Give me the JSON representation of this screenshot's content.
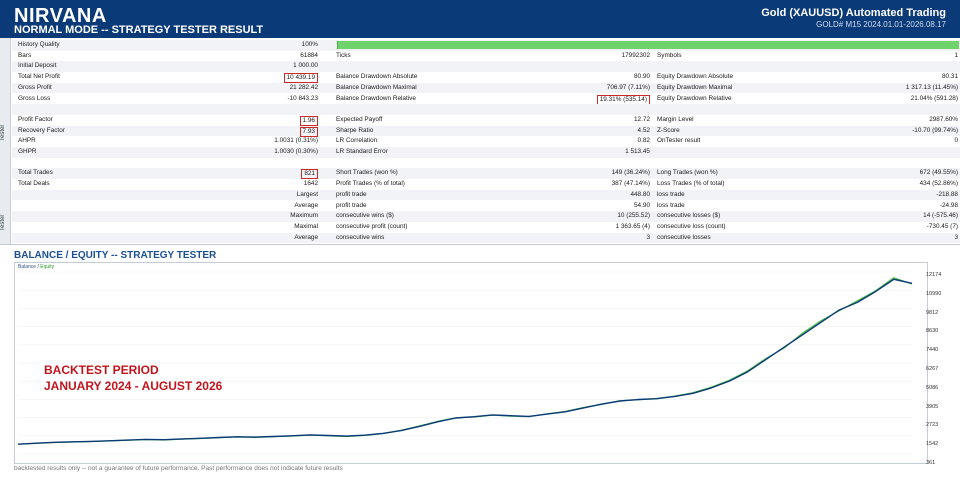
{
  "header": {
    "title": "NIRVANA",
    "subtitle": "NORMAL MODE -- STRATEGY TESTER RESULT",
    "right_title": "Gold (XAUUSD) Automated Trading",
    "right_sub": "GOLD# M15 2024.01.01-2026.08.17"
  },
  "sidebar": {
    "tab1": "Tester",
    "tab2": "Tester"
  },
  "report": {
    "rows": [
      {
        "l1": "History Quality",
        "v1": "100%",
        "l2": "",
        "v2": "",
        "l3": "",
        "v3": "",
        "bar": true
      },
      {
        "l1": "Bars",
        "v1": "61884",
        "l2": "Ticks",
        "v2": "17992302",
        "l3": "Symbols",
        "v3": "1"
      },
      {
        "l1": "Initial Deposit",
        "v1": "1 000.00",
        "l2": "",
        "v2": "",
        "l3": "",
        "v3": ""
      },
      {
        "l1": "Total Net Profit",
        "v1": "10 439.19",
        "b1": true,
        "l2": "Balance Drawdown Absolute",
        "v2": "80.90",
        "l3": "Equity Drawdown Absolute",
        "v3": "80.31"
      },
      {
        "l1": "Gross Profit",
        "v1": "21 282.42",
        "l2": "Balance Drawdown Maximal",
        "v2": "706.97 (7.11%)",
        "l3": "Equity Drawdown Maximal",
        "v3": "1 317.13 (11.45%)"
      },
      {
        "l1": "Gross Loss",
        "v1": "-10 843.23",
        "l2": "Balance Drawdown Relative",
        "v2": "19.31% (535.14)",
        "b2": true,
        "l3": "Equity Drawdown Relative",
        "v3": "21.04% (591.28)"
      },
      {
        "l1": "",
        "v1": "",
        "l2": "",
        "v2": "",
        "l3": "",
        "v3": ""
      },
      {
        "l1": "Profit Factor",
        "v1": "1.96",
        "b1": true,
        "l2": "Expected Payoff",
        "v2": "12.72",
        "l3": "Margin Level",
        "v3": "2987.60%"
      },
      {
        "l1": "Recovery Factor",
        "v1": "7.93",
        "b1": true,
        "l2": "Sharpe Ratio",
        "v2": "4.52",
        "l3": "Z-Score",
        "v3": "-10.70 (99.74%)"
      },
      {
        "l1": "AHPR",
        "v1": "1.0031 (0.31%)",
        "l2": "LR Correlation",
        "v2": "0.82",
        "l3": "OnTester result",
        "v3": "0"
      },
      {
        "l1": "GHPR",
        "v1": "1.0030 (0.30%)",
        "l2": "LR Standard Error",
        "v2": "1 513.45",
        "l3": "",
        "v3": ""
      },
      {
        "l1": "",
        "v1": "",
        "l2": "",
        "v2": "",
        "l3": "",
        "v3": ""
      },
      {
        "l1": "Total Trades",
        "v1": "821",
        "b1": true,
        "l2": "Short Trades (won %)",
        "v2": "149 (36.24%)",
        "l3": "Long Trades (won %)",
        "v3": "672 (49.55%)"
      },
      {
        "l1": "Total Deals",
        "v1": "1642",
        "l2": "Profit Trades (% of total)",
        "v2": "387 (47.14%)",
        "l3": "Loss Trades (% of total)",
        "v3": "434 (52.86%)"
      },
      {
        "l1": "",
        "v1": "Largest",
        "l2": "profit trade",
        "v2": "448.80",
        "l3": "loss trade",
        "v3": "-218.88"
      },
      {
        "l1": "",
        "v1": "Average",
        "l2": "profit trade",
        "v2": "54.90",
        "l3": "loss trade",
        "v3": "-24.98"
      },
      {
        "l1": "",
        "v1": "Maximum",
        "l2": "consecutive wins ($)",
        "v2": "10 (255.52)",
        "l3": "consecutive losses ($)",
        "v3": "14 (-575.46)"
      },
      {
        "l1": "",
        "v1": "Maximal",
        "l2": "consecutive profit (count)",
        "v2": "1 363.65 (4)",
        "l3": "consecutive loss (count)",
        "v3": "-730.45 (7)"
      },
      {
        "l1": "",
        "v1": "Average",
        "l2": "consecutive wins",
        "v2": "3",
        "l3": "consecutive losses",
        "v3": "3"
      }
    ]
  },
  "chart": {
    "title": "BALANCE / EQUITY -- STRATEGY TESTER",
    "legend_balance": "Balance",
    "legend_sep": " / ",
    "legend_equity": "Equity",
    "annotation_line1": "BACKTEST PERIOD",
    "annotation_line2": "JANUARY 2024 - AUGUST 2026",
    "y_ticks": [
      "12174",
      "10990",
      "9812",
      "8630",
      "7440",
      "6267",
      "5086",
      "3905",
      "2723",
      "1542",
      "361"
    ],
    "colors": {
      "balance": "#0b3a78",
      "equity": "#3db83d",
      "annotation": "#c2151d"
    }
  },
  "chart_data": {
    "type": "line",
    "title": "BALANCE / EQUITY -- STRATEGY TESTER",
    "ylim": [
      361,
      12174
    ],
    "series": [
      {
        "name": "Balance",
        "values": [
          1000,
          1060,
          1120,
          1150,
          1180,
          1220,
          1260,
          1310,
          1290,
          1340,
          1380,
          1430,
          1480,
          1460,
          1500,
          1540,
          1600,
          1560,
          1520,
          1580,
          1700,
          1880,
          2150,
          2450,
          2700,
          2780,
          2900,
          2850,
          2800,
          2950,
          3100,
          3350,
          3600,
          3800,
          3900,
          3950,
          4100,
          4300,
          4650,
          5100,
          5700,
          6500,
          7300,
          8100,
          8900,
          9700,
          10200,
          10900,
          11700,
          11439
        ]
      },
      {
        "name": "Equity",
        "values": [
          1000,
          1050,
          1110,
          1140,
          1170,
          1210,
          1250,
          1300,
          1270,
          1330,
          1370,
          1420,
          1470,
          1440,
          1490,
          1530,
          1590,
          1540,
          1500,
          1570,
          1690,
          1900,
          2180,
          2480,
          2720,
          2760,
          2880,
          2820,
          2780,
          2970,
          3120,
          3380,
          3580,
          3820,
          3880,
          3960,
          4120,
          4340,
          4700,
          5150,
          5760,
          6560,
          7250,
          8200,
          9000,
          9650,
          10300,
          10950,
          11800,
          11400
        ]
      }
    ]
  },
  "footer": "backtested results only -- not a guarantee of future performance. Past performance does not indicate future results"
}
